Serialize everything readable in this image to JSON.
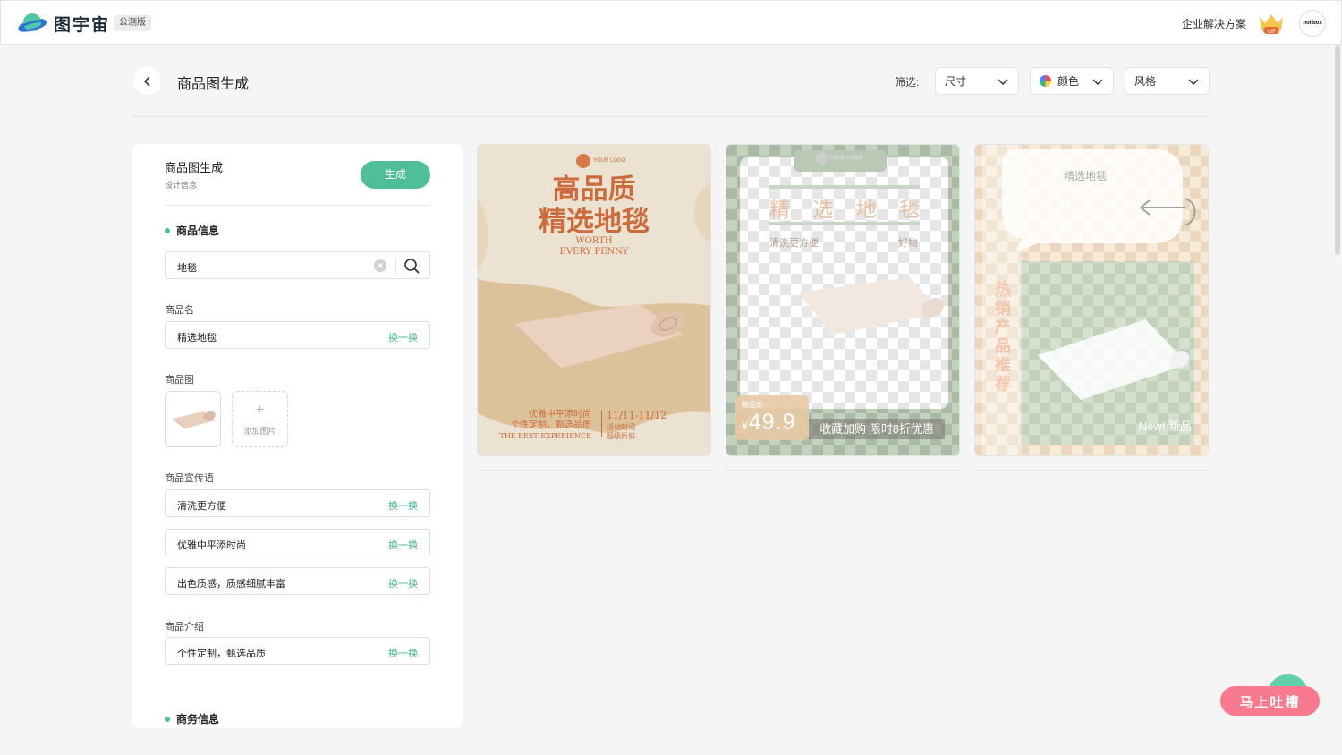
{
  "header": {
    "logo_text": "图宇宙",
    "beta_badge": "公测版",
    "enterprise_link": "企业解决方案",
    "vip_label": "VIP",
    "avatar_text": "nolibox"
  },
  "page": {
    "title": "商品图生成",
    "filter_label": "筛选:",
    "filters": [
      {
        "label": "尺寸",
        "icon": "chevron-down-icon"
      },
      {
        "label": "颜色",
        "icon": "color-wheel-icon"
      },
      {
        "label": "风格",
        "icon": "chevron-down-icon"
      }
    ]
  },
  "panel": {
    "title": "商品图生成",
    "subtitle": "设计信息",
    "generate_label": "生成",
    "product_section": "商品信息",
    "search_value": "地毯",
    "name_label": "商品名",
    "name_value": "精选地毯",
    "swap_label": "换一换",
    "image_label": "商品图",
    "add_image_label": "添加图片",
    "slogan_label": "商品宣传语",
    "slogans": [
      "清洗更方便",
      "优雅中平添时尚",
      "出色质感，质感细腻丰富"
    ],
    "intro_label": "商品介绍",
    "intro_value": "个性定制，甄选品质",
    "business_section": "商务信息"
  },
  "cards": [
    {
      "logo": "YOUR LOGO",
      "headline_1": "高品质",
      "headline_2": "精选地毯",
      "tag_1": "WORTH",
      "tag_2": "EVERY PENNY",
      "bottom_1": "优雅中平添时尚",
      "bottom_2": "个性定制，甄选品质",
      "bottom_3": "THE BEST EXPERIENCE",
      "date": "11/11-11/12",
      "event_1": "活动时间",
      "event_2": "超级折扣"
    },
    {
      "logo": "YOUR LOGO",
      "title_chars": [
        "精",
        "选",
        "地",
        "毯"
      ],
      "sub_left": "清洗更方便",
      "sub_right": "好物",
      "price_label": "新品价",
      "currency": "¥",
      "price": "49.9",
      "promo": "收藏加购 限时8折优惠"
    },
    {
      "title": "精选地毯",
      "vertical_text": "热销产品推荐",
      "new_label": "New! 新品"
    }
  ],
  "feedback_label": "马上吐槽",
  "colors": {
    "accent": "#4fbf9a",
    "card1_text": "#cc6b3c",
    "feedback": "#f9798e"
  }
}
